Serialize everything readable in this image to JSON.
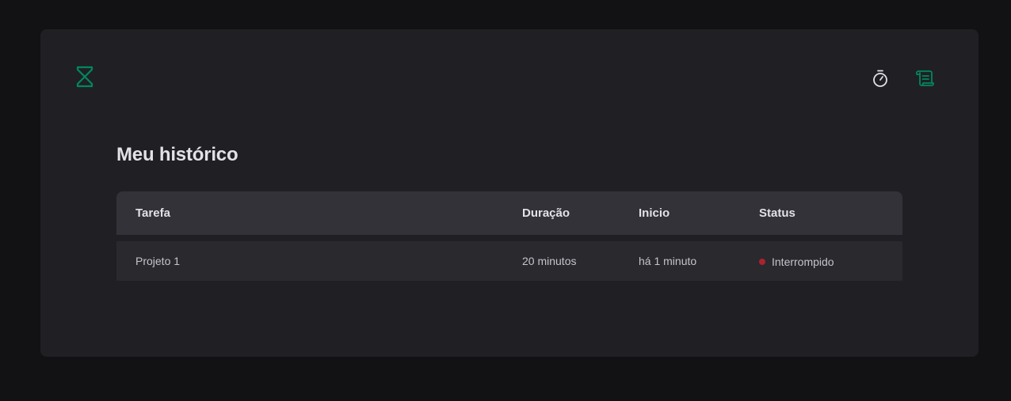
{
  "header": {
    "logo_icon": "hourglass-icon",
    "nav": [
      {
        "icon": "timer-icon",
        "color": "#e1e1e6"
      },
      {
        "icon": "scroll-icon",
        "color": "#00875f"
      }
    ]
  },
  "page": {
    "title": "Meu histórico"
  },
  "table": {
    "columns": [
      "Tarefa",
      "Duração",
      "Inicio",
      "Status"
    ],
    "rows": [
      {
        "task": "Projeto 1",
        "duration": "20 minutos",
        "start": "há 1 minuto",
        "status": "Interrompido",
        "status_color": "#ab222e"
      }
    ]
  },
  "colors": {
    "brand": "#00875f",
    "background": "#121214",
    "panel": "#202024"
  }
}
